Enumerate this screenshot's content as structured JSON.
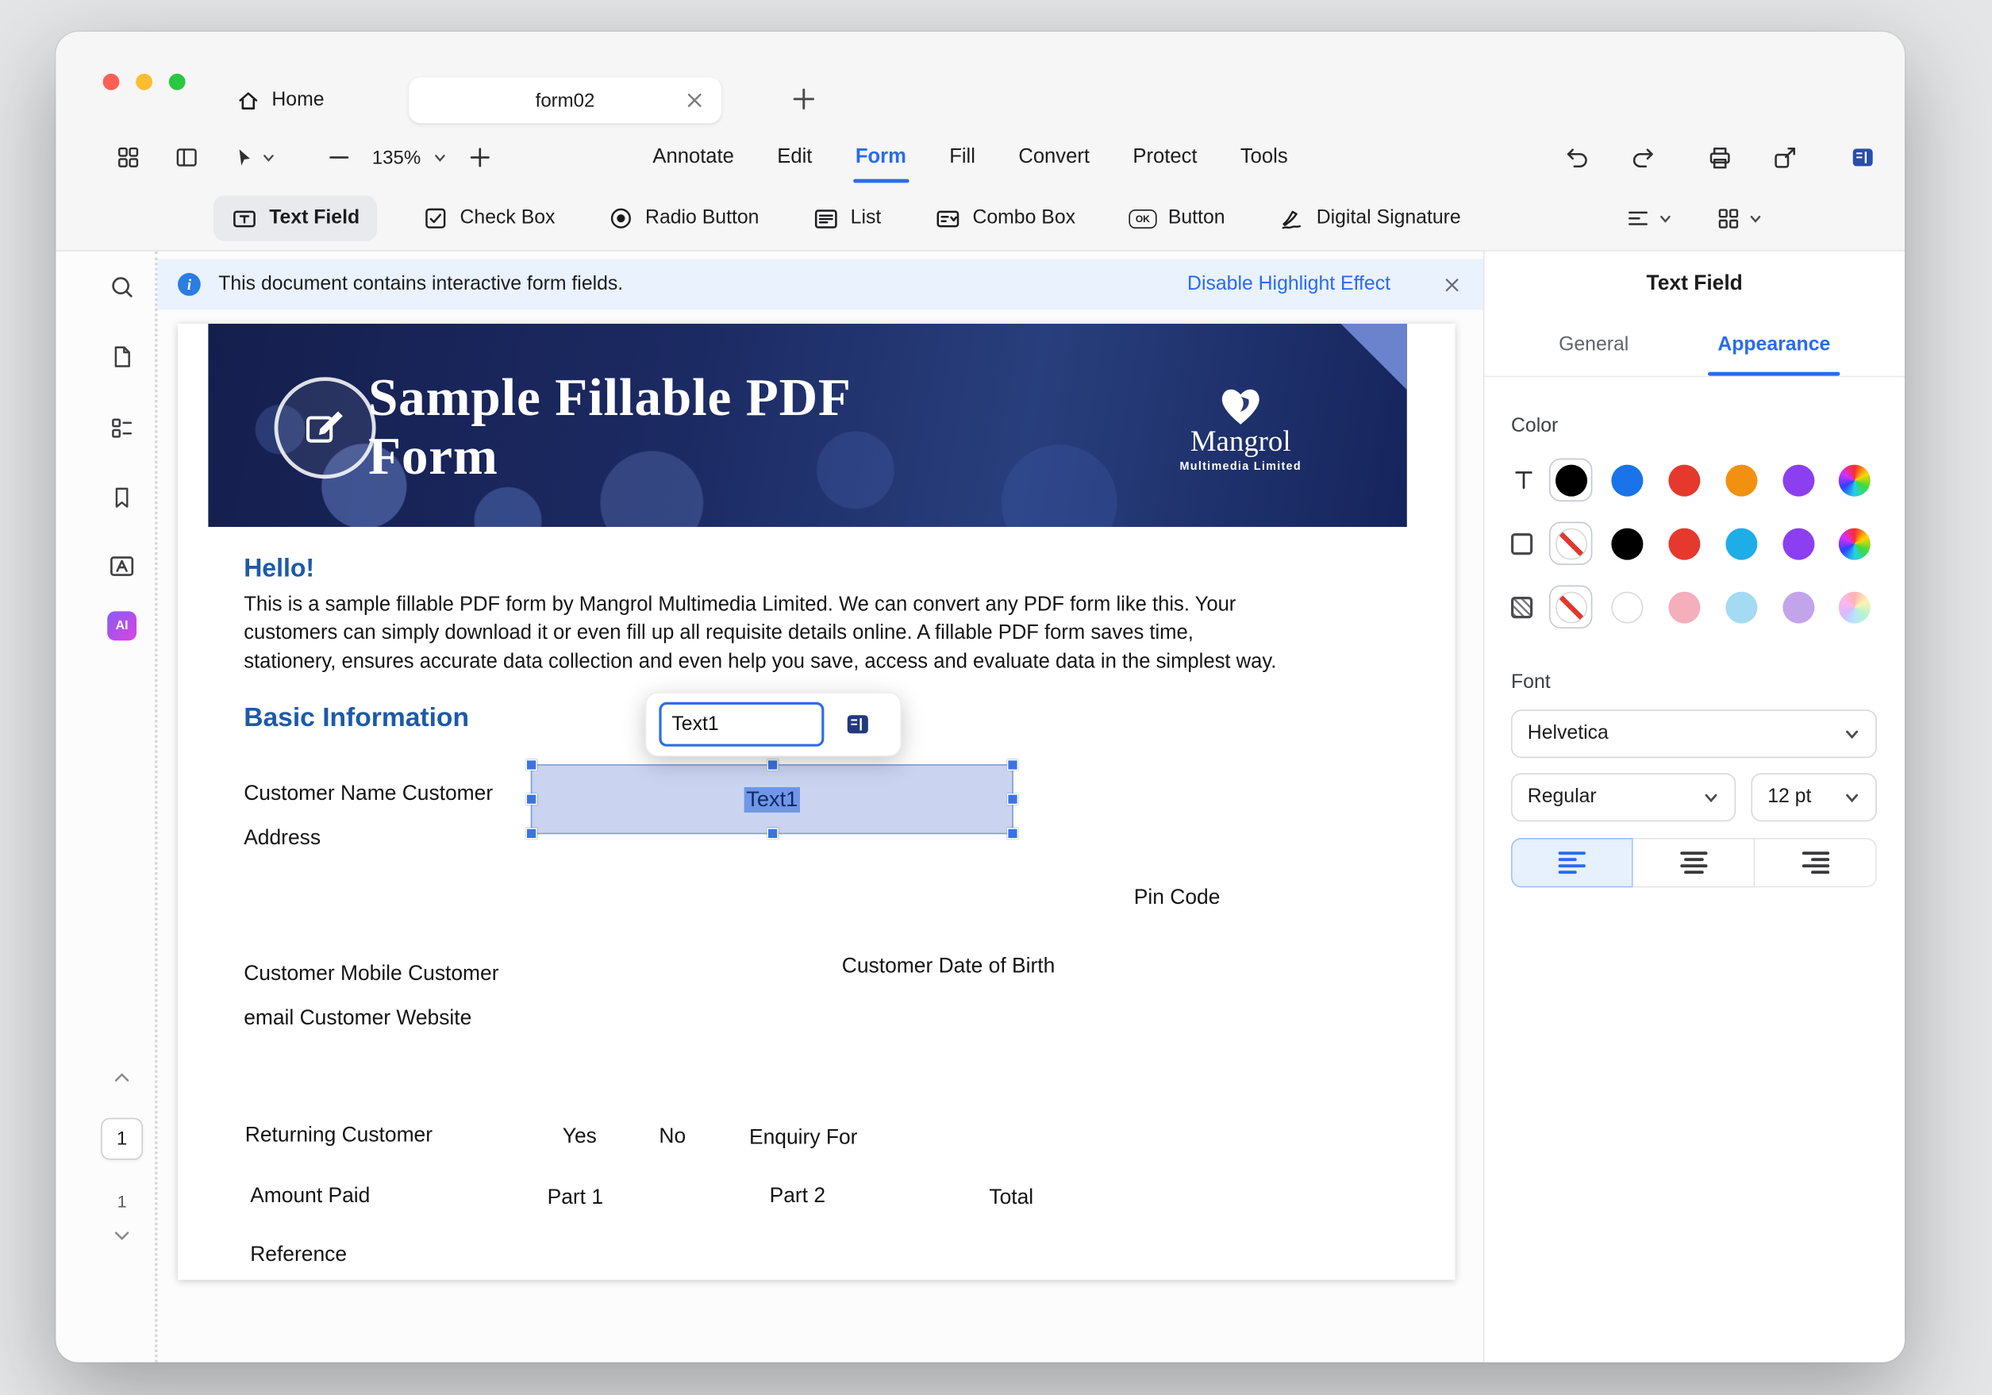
{
  "accent_color": "#2a6af0",
  "titlebar": {
    "home_label": "Home",
    "document_tab_label": "form02"
  },
  "toolbar": {
    "zoom_level": "135%",
    "menu": {
      "annotate": "Annotate",
      "edit": "Edit",
      "form": "Form",
      "fill": "Fill",
      "convert": "Convert",
      "protect": "Protect",
      "tools": "Tools"
    }
  },
  "form_toolbar": {
    "text_field": "Text Field",
    "check_box": "Check Box",
    "radio_button": "Radio Button",
    "list": "List",
    "combo_box": "Combo Box",
    "button": "Button",
    "digital_signature": "Digital Signature"
  },
  "icons": {
    "ok_glyph": "OK",
    "ai_glyph": "AI"
  },
  "info_bar": {
    "message": "This document contains interactive form fields.",
    "action_label": "Disable Highlight Effect"
  },
  "sidebar": {
    "current_page": "1",
    "total_pages": "1"
  },
  "document": {
    "banner": {
      "title_line1": "Sample Fillable PDF",
      "title_line2": "Form",
      "logo_name": "Mangrol",
      "logo_subtitle": "Multimedia Limited"
    },
    "greeting": "Hello!",
    "intro_lines": {
      "line1": "This is a sample fillable PDF form by Mangrol Multimedia Limited. We can convert any PDF form like this. Your",
      "line2": "customers can simply download it or even fill up all requisite details online. A fillable PDF form saves time,",
      "line3": "stationery, ensures accurate data collection and even help you save, access and evaluate data in the simplest way."
    },
    "section_title": "Basic Information",
    "labels": {
      "customer_name": "Customer Name Customer",
      "address": "Address",
      "pin_code": "Pin Code",
      "customer_mobile": "Customer Mobile Customer",
      "email_website": "email Customer Website",
      "date_of_birth": "Customer Date of Birth",
      "returning_customer": "Returning Customer",
      "yes": "Yes",
      "no": "No",
      "enquiry_for": "Enquiry For",
      "amount_paid": "Amount Paid",
      "part1": "Part 1",
      "part2": "Part 2",
      "total": "Total",
      "reference": "Reference"
    },
    "selected_field_text": "Text1",
    "field_popup_value": "Text1"
  },
  "right_panel": {
    "title": "Text Field",
    "tabs": {
      "general": "General",
      "appearance": "Appearance"
    },
    "color_section_label": "Color",
    "font_section_label": "Font",
    "font_family": "Helvetica",
    "font_style": "Regular",
    "font_size": "12 pt",
    "color_rows": [
      {
        "target": "text-color",
        "selected_index": 0,
        "swatches": [
          "#000000",
          "#1a73e8",
          "#e6392d",
          "#f29111",
          "#8b3ff0",
          "rainbow"
        ]
      },
      {
        "target": "border-color",
        "selected_index": 0,
        "swatches": [
          "none",
          "#000000",
          "#e6392d",
          "#1fade8",
          "#8b3ff0",
          "rainbow"
        ]
      },
      {
        "target": "fill-color",
        "selected_index": 0,
        "swatches": [
          "none",
          "#ffffff",
          "#f5aebb",
          "#a5daf3",
          "#c2a4eb",
          "rainbow-light"
        ]
      }
    ]
  }
}
